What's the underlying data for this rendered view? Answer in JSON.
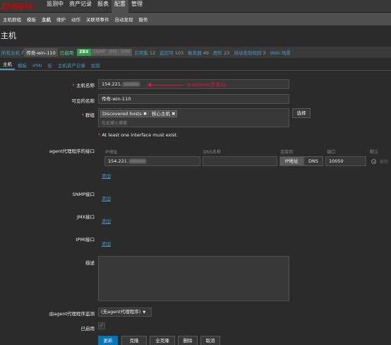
{
  "logo": "ZABBIX",
  "main_menu": [
    "监测中",
    "资产记录",
    "报表",
    "配置",
    "管理"
  ],
  "sub_menu": [
    "主机群组",
    "模板",
    "主机",
    "维护",
    "动作",
    "关联项事件",
    "自动发现",
    "服务"
  ],
  "page_title": "主机",
  "host_bar": {
    "all_hosts": "所有主机",
    "sep": "/",
    "current_host": "传奇-win-110",
    "status": "已启用",
    "availability": [
      "ZBX",
      "SNMP",
      "JMX",
      "IPMI"
    ],
    "links": [
      {
        "label": "应用集",
        "count": "12"
      },
      {
        "label": "监控项",
        "count": "103"
      },
      {
        "label": "触发器",
        "count": "49"
      },
      {
        "label": "图形",
        "count": "23"
      },
      {
        "label": "自动发现规则",
        "count": "3"
      },
      {
        "label": "Web 场景",
        "count": ""
      }
    ]
  },
  "form_tabs": [
    "主机",
    "模板",
    "IPMI",
    "宏",
    "主机资产记录",
    "加密"
  ],
  "form": {
    "host_name_label": "主机名称",
    "host_name_value": "154.221.",
    "annotation": "windows主机ip",
    "visible_name_label": "可见的名称",
    "visible_name_value": "传奇-win-110",
    "groups_label": "群组",
    "groups": [
      "Discovered hosts",
      "核心主机"
    ],
    "groups_placeholder": "在此输入搜索",
    "select_button": "选择",
    "interface_error": "At least one interface must exist.",
    "agent_label": "agent代理程序的接口",
    "interface_headers": {
      "ip": "IP地址",
      "dns": "DNS名称",
      "connect_to": "连接到",
      "port": "端口",
      "default": "默认"
    },
    "agent_ip": "154.221.",
    "agent_ip_button": "IP地址",
    "agent_dns_button": "DNS",
    "agent_port": "10050",
    "agent_remove": "移除",
    "add_link": "添加",
    "snmp_label": "SNMP接口",
    "jmx_label": "JMX接口",
    "ipmi_label": "IPMI接口",
    "description_label": "描述",
    "proxy_label": "由agent代理程序监测",
    "proxy_value": "(无agent代理程序)",
    "enabled_label": "已启用",
    "buttons": [
      "更新",
      "克隆",
      "全克隆",
      "删除",
      "取消"
    ]
  }
}
